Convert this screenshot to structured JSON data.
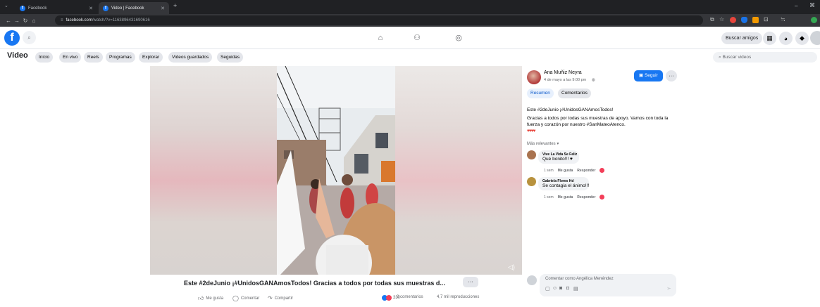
{
  "browser": {
    "tabs": [
      {
        "label": "Facebook",
        "active": false
      },
      {
        "label": "Video | Facebook",
        "active": true
      }
    ],
    "new_tab": "+",
    "url_host": "facebook.com",
    "url_path": "/watch/?v=1163896431690616",
    "window_minimize": "–"
  },
  "header": {
    "find_friends_label": "Buscar amigos"
  },
  "videobar": {
    "title": "Video",
    "pills": [
      "Inicio",
      "En vivo",
      "Reels",
      "Programas",
      "Explorar",
      "Videos guardados",
      "Seguidas"
    ],
    "search_placeholder": "Buscar videos"
  },
  "post": {
    "author": "Ana Muñiz Neyra",
    "date": "4 de mayo a las 9:00 pm",
    "follow_label": "Seguir",
    "tabs": [
      "Resumen",
      "Comentarios"
    ],
    "text_line1_prefix": "Este #2deJunio ¡#UnidosGANAmosTodos!",
    "text_line2": "Gracias a todos por todas sus muestras de apoyo. Vamos con toda la",
    "text_line3": "fuerza y corazón por nuestro #SanMateoAtenco.",
    "emojis": "♥♥♥♥",
    "sort_label": "Más relevantes",
    "comments": [
      {
        "name": "Vive La Vida Se Feliz",
        "text": "Qué bonito!!! ♥",
        "time": "1 sem",
        "like": "Me gusta",
        "reply": "Responder"
      },
      {
        "name": "Gabriela Flores Hd",
        "text": "Se contagia el ánimo!!!",
        "time": "1 sem",
        "like": "Me gusta",
        "reply": "Responder"
      }
    ],
    "comment_placeholder": "Comentar como Angélica Menéndez"
  },
  "video": {
    "title": "Este #2deJunio ¡#UnidosGANAmosTodos! Gracias a todos por todas sus muestras d...",
    "more_label": "···",
    "like_label": "Me gusta",
    "comment_label": "Comentar",
    "share_label": "Compartir",
    "reactions_count": "330",
    "comments_count": "2 comentarios",
    "views": "4,7 mil reproducciones"
  }
}
